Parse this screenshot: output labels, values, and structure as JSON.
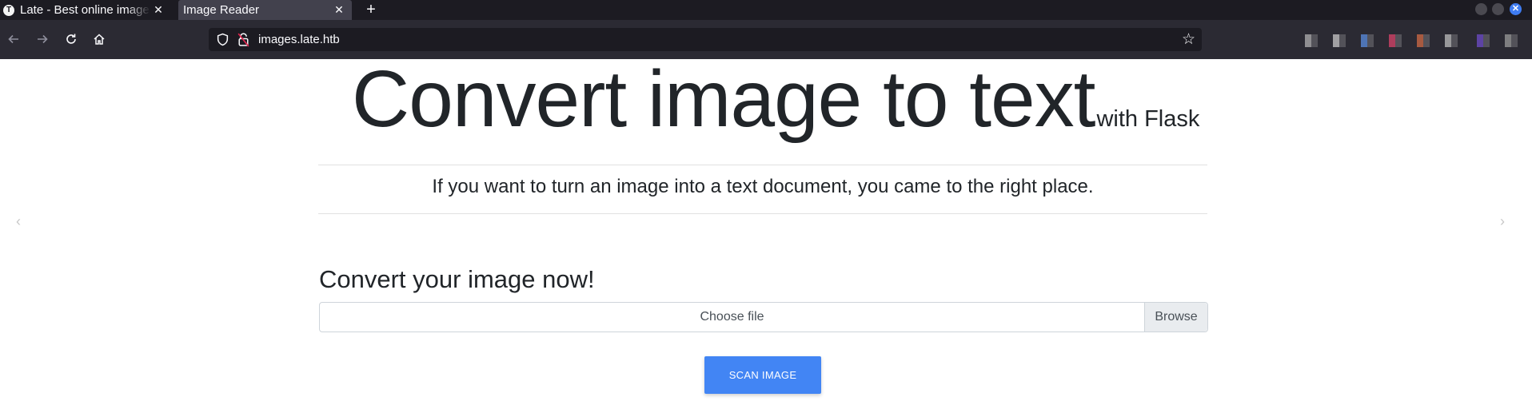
{
  "browser": {
    "tabs": [
      {
        "title": "Late - Best online image tools",
        "favicon": "T",
        "active": false
      },
      {
        "title": "Image Reader",
        "active": true
      }
    ],
    "new_tab_glyph": "+",
    "close_glyph": "✕",
    "url": "images.late.htb",
    "nav_icons": [
      "back-arrow-icon",
      "forward-arrow-icon",
      "reload-icon",
      "home-icon"
    ],
    "extension_icon_colors": [
      "#b0b0b0",
      "#c8c8c8",
      "#5a8de0",
      "#d9436a",
      "#d06a45",
      "#bdbdbd",
      "#6e4bc9",
      "#9a9a9a"
    ]
  },
  "page": {
    "hero_title": "Convert image to text",
    "hero_subtitle": "with Flask",
    "lead_text": "If you want to turn an image into a text document, you came to the right place.",
    "form_heading": "Convert your image now!",
    "file_label": "Choose file",
    "browse_label": "Browse",
    "scan_button": "SCAN IMAGE",
    "carousel_prev": "‹",
    "carousel_next": "›",
    "accent_color": "#4285f4"
  }
}
